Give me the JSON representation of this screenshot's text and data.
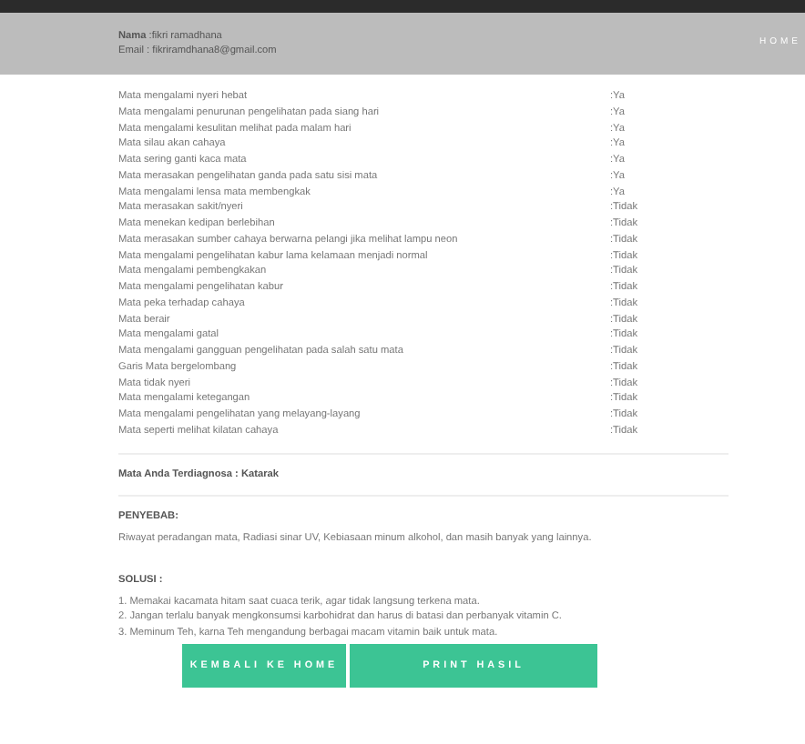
{
  "header": {
    "name_line": "**Nama** :fikri ramadhana",
    "email_line": "Email : fikriramdhana8@gmail.com",
    "nav_link": "HOME"
  },
  "symptoms": [
    {
      "question": "Mata mengalami nyeri hebat",
      "answer": ":Ya"
    },
    {
      "question": "Mata mengalami penurunan pengelihatan pada siang hari",
      "answer": ":Ya"
    },
    {
      "question": "Mata mengalami kesulitan melihat pada malam hari",
      "answer": ":Ya"
    },
    {
      "question": "Mata silau akan cahaya",
      "answer": ":Ya"
    },
    {
      "question": "Mata sering ganti kaca mata",
      "answer": ":Ya"
    },
    {
      "question": "Mata merasakan pengelihatan ganda pada satu sisi mata",
      "answer": ":Ya"
    },
    {
      "question": "Mata mengalami lensa mata membengkak",
      "answer": ":Ya"
    },
    {
      "question": "Mata merasakan sakit/nyeri",
      "answer": ":Tidak"
    },
    {
      "question": "Mata menekan kedipan berlebihan",
      "answer": ":Tidak"
    },
    {
      "question": "Mata merasakan sumber cahaya berwarna pelangi jika melihat lampu neon",
      "answer": ":Tidak"
    },
    {
      "question": "Mata mengalami pengelihatan kabur lama kelamaan menjadi normal",
      "answer": ":Tidak"
    },
    {
      "question": "Mata mengalami pembengkakan",
      "answer": ":Tidak"
    },
    {
      "question": "Mata mengalami pengelihatan kabur",
      "answer": ":Tidak"
    },
    {
      "question": "Mata peka terhadap cahaya",
      "answer": ":Tidak"
    },
    {
      "question": "Mata berair",
      "answer": ":Tidak"
    },
    {
      "question": "Mata mengalami gatal",
      "answer": ":Tidak"
    },
    {
      "question": "Mata mengalami gangguan pengelihatan pada salah satu mata",
      "answer": ":Tidak"
    },
    {
      "question": "Garis Mata bergelombang",
      "answer": ":Tidak"
    },
    {
      "question": "Mata tidak nyeri",
      "answer": ":Tidak"
    },
    {
      "question": "Mata mengalami ketegangan",
      "answer": ":Tidak"
    },
    {
      "question": "Mata mengalami pengelihatan yang melayang-layang",
      "answer": ":Tidak"
    },
    {
      "question": "Mata seperti melihat kilatan cahaya",
      "answer": ":Tidak"
    }
  ],
  "diagnosis": "Mata Anda Terdiagnosa : Katarak",
  "cause": {
    "heading": "PENYEBAB:",
    "text": "Riwayat peradangan mata, Radiasi sinar UV, Kebiasaan minum alkohol, dan masih banyak yang lainnya."
  },
  "solution": {
    "heading": "SOLUSI :",
    "items": [
      "1. Memakai kacamata hitam saat cuaca terik, agar tidak langsung terkena mata.",
      "2. Jangan terlalu banyak mengkonsumsi karbohidrat dan harus di batasi dan perbanyak vitamin C.",
      "3. Meminum Teh, karna Teh mengandung berbagai macam vitamin baik untuk mata."
    ]
  },
  "buttons": [
    "KEMBALI KE HOME",
    "PRINT HASIL"
  ]
}
